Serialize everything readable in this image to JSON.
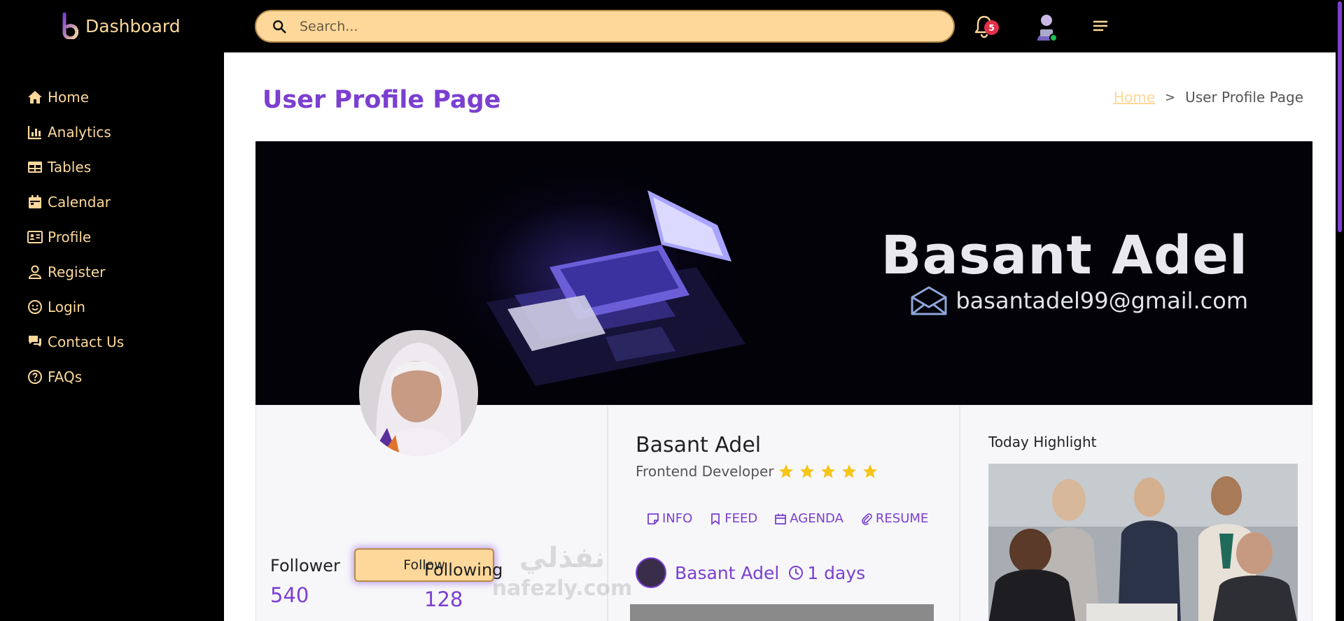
{
  "app": {
    "brand": "Dashboard"
  },
  "search": {
    "placeholder": "Search..."
  },
  "notifications": {
    "count": "5"
  },
  "sidebar": {
    "items": [
      {
        "label": "Home",
        "icon": "home-icon"
      },
      {
        "label": "Analytics",
        "icon": "bar-chart-icon"
      },
      {
        "label": "Tables",
        "icon": "table-icon"
      },
      {
        "label": "Calendar",
        "icon": "calendar-icon"
      },
      {
        "label": "Profile",
        "icon": "id-card-icon"
      },
      {
        "label": "Register",
        "icon": "person-icon"
      },
      {
        "label": "Login",
        "icon": "smile-icon"
      },
      {
        "label": "Contact Us",
        "icon": "chat-icon"
      },
      {
        "label": "FAQs",
        "icon": "question-circle-icon"
      }
    ]
  },
  "page": {
    "title": "User Profile Page",
    "breadcrumb": {
      "home": "Home",
      "separator": ">",
      "current": "User Profile Page"
    }
  },
  "cover": {
    "name": "Basant Adel",
    "email": "basantadel99@gmail.com"
  },
  "profile": {
    "follow_label": "Follow",
    "follower_label": "Follower",
    "follower_value": "540",
    "following_label": "Following",
    "following_value": "128",
    "name": "Basant Adel",
    "role": "Frontend Developer",
    "rating": 5
  },
  "tabs": [
    {
      "label": "INFO",
      "icon": "note-icon"
    },
    {
      "label": "FEED",
      "icon": "bookmark-icon"
    },
    {
      "label": "AGENDA",
      "icon": "calendar-icon"
    },
    {
      "label": "RESUME",
      "icon": "paperclip-icon"
    }
  ],
  "feed": {
    "author": "Basant Adel",
    "time": "1 days"
  },
  "highlight": {
    "title": "Today Highlight"
  },
  "colors": {
    "accent": "#7b3fd0",
    "cream": "#fdd89a",
    "background": "#000000",
    "star": "#f5c518"
  }
}
